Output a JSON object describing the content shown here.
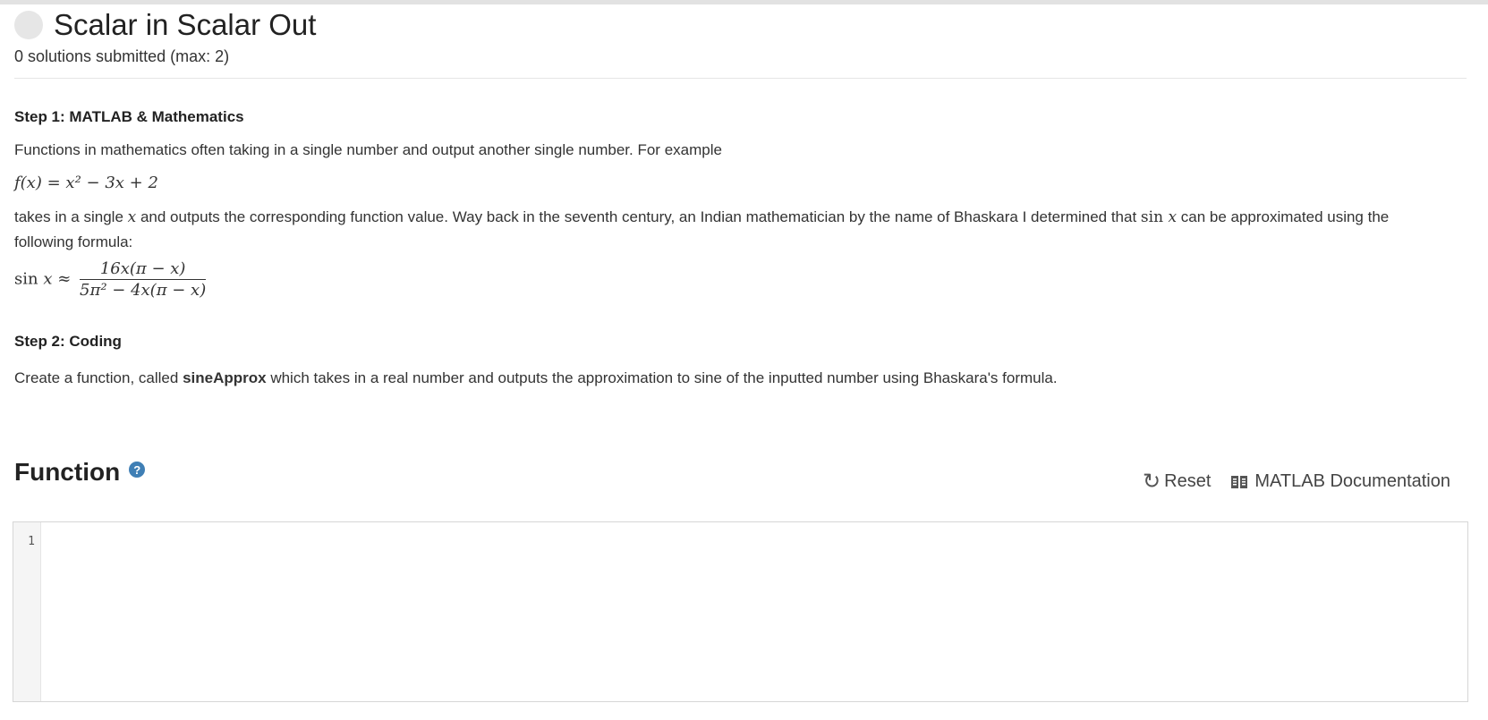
{
  "problem": {
    "title": "Scalar in Scalar Out",
    "submissions": "0 solutions submitted (max: 2)"
  },
  "description": {
    "step1_heading": "Step 1: MATLAB & Mathematics",
    "para1": "Functions in mathematics often taking in a single number and output another single number. For example",
    "eq1": {
      "lhs": "f(x)",
      "eq": "=",
      "rhs": "x² − 3x + 2"
    },
    "para2_a": "takes in a single ",
    "para2_var": "x",
    "para2_b": " and outputs the corresponding function value. Way back in the seventh century, an Indian mathematician by the name of Bhaskara I determined that ",
    "para2_fn": "sin",
    "para2_fnvar": "x",
    "para2_c": " can be approximated using the following formula:",
    "eq2": {
      "lhs_fn": "sin",
      "lhs_var": "x",
      "approx": "≈",
      "numerator": "16x(π − x)",
      "denominator": "5π² − 4x(π − x)"
    },
    "step2_heading": "Step 2: Coding",
    "para3_a": "Create a function, called ",
    "para3_bold": "sineApprox",
    "para3_b": " which takes in a real number and outputs the approximation to sine of the inputted number using Bhaskara's formula."
  },
  "function_section": {
    "heading": "Function",
    "help_glyph": "?",
    "reset_label": "Reset",
    "docs_label": "MATLAB Documentation",
    "icons": {
      "reset": "refresh-icon",
      "docs": "book-icon",
      "help": "question-circle-icon"
    }
  },
  "editor": {
    "line_numbers": [
      "1"
    ],
    "code": ""
  }
}
